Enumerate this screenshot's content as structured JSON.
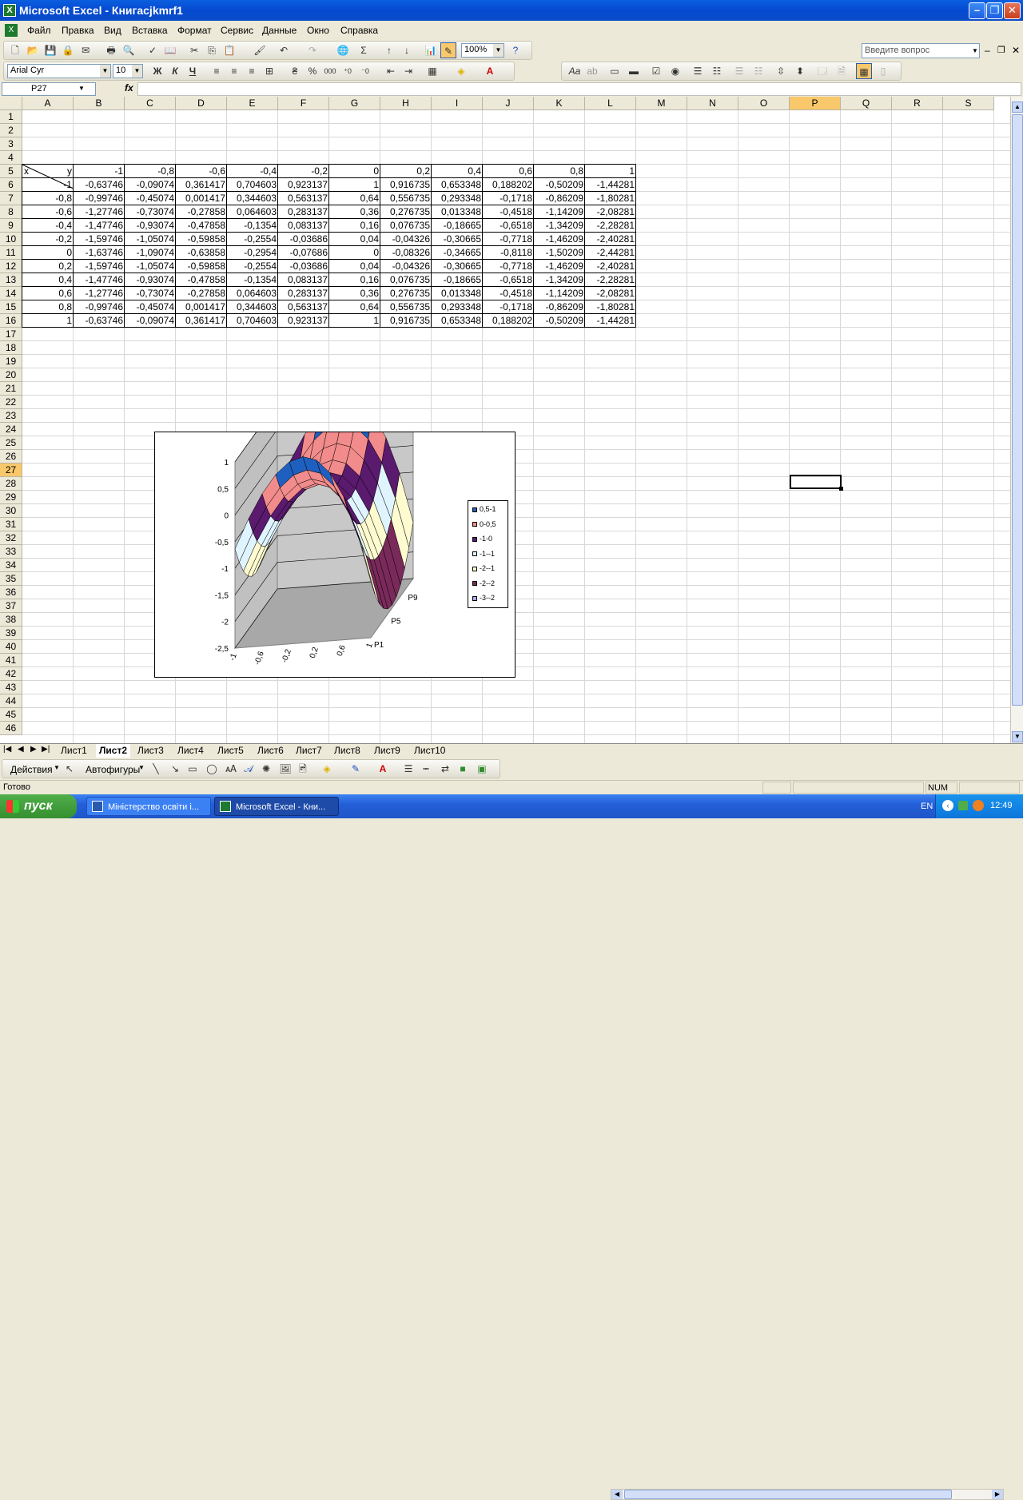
{
  "window": {
    "title": "Microsoft Excel - Книгаcjkmrf1",
    "icon": "excel-icon"
  },
  "menu": {
    "items": [
      "Файл",
      "Правка",
      "Вид",
      "Вставка",
      "Формат",
      "Сервис",
      "Данные",
      "Окно",
      "Справка"
    ],
    "question_placeholder": "Введите вопрос"
  },
  "toolbar": {
    "zoom": "100%",
    "font": "Arial Cyr",
    "size": "10"
  },
  "formula_bar": {
    "name_box": "P27",
    "fx_label": "fx",
    "content": ""
  },
  "columns": [
    "A",
    "B",
    "C",
    "D",
    "E",
    "F",
    "G",
    "H",
    "I",
    "J",
    "K",
    "L",
    "M",
    "N",
    "O",
    "P",
    "Q",
    "R",
    "S"
  ],
  "rows": [
    "1",
    "2",
    "3",
    "4",
    "5",
    "6",
    "7",
    "8",
    "9",
    "10",
    "11",
    "12",
    "13",
    "14",
    "15",
    "16",
    "17",
    "18",
    "19",
    "20",
    "21",
    "22",
    "23",
    "24",
    "25",
    "26",
    "27",
    "28",
    "29",
    "30",
    "31",
    "32",
    "33",
    "34",
    "35",
    "36",
    "37",
    "38",
    "39",
    "40",
    "41",
    "42",
    "43",
    "44",
    "45",
    "46"
  ],
  "selected": {
    "column": "P",
    "row": "27"
  },
  "table": {
    "corner_x": "x",
    "corner_y": "y",
    "header": [
      "-1",
      "-0,8",
      "-0,6",
      "-0,4",
      "-0,2",
      "0",
      "0,2",
      "0,4",
      "0,6",
      "0,8",
      "1"
    ],
    "body": [
      [
        "-1",
        "-0,63746",
        "-0,09074",
        "0,361417",
        "0,704603",
        "0,923137",
        "1",
        "0,916735",
        "0,653348",
        "0,188202",
        "-0,50209",
        "-1,44281"
      ],
      [
        "-0,8",
        "-0,99746",
        "-0,45074",
        "0,001417",
        "0,344603",
        "0,563137",
        "0,64",
        "0,556735",
        "0,293348",
        "-0,1718",
        "-0,86209",
        "-1,80281"
      ],
      [
        "-0,6",
        "-1,27746",
        "-0,73074",
        "-0,27858",
        "0,064603",
        "0,283137",
        "0,36",
        "0,276735",
        "0,013348",
        "-0,4518",
        "-1,14209",
        "-2,08281"
      ],
      [
        "-0,4",
        "-1,47746",
        "-0,93074",
        "-0,47858",
        "-0,1354",
        "0,083137",
        "0,16",
        "0,076735",
        "-0,18665",
        "-0,6518",
        "-1,34209",
        "-2,28281"
      ],
      [
        "-0,2",
        "-1,59746",
        "-1,05074",
        "-0,59858",
        "-0,2554",
        "-0,03686",
        "0,04",
        "-0,04326",
        "-0,30665",
        "-0,7718",
        "-1,46209",
        "-2,40281"
      ],
      [
        "0",
        "-1,63746",
        "-1,09074",
        "-0,63858",
        "-0,2954",
        "-0,07686",
        "0",
        "-0,08326",
        "-0,34665",
        "-0,8118",
        "-1,50209",
        "-2,44281"
      ],
      [
        "0,2",
        "-1,59746",
        "-1,05074",
        "-0,59858",
        "-0,2554",
        "-0,03686",
        "0,04",
        "-0,04326",
        "-0,30665",
        "-0,7718",
        "-1,46209",
        "-2,40281"
      ],
      [
        "0,4",
        "-1,47746",
        "-0,93074",
        "-0,47858",
        "-0,1354",
        "0,083137",
        "0,16",
        "0,076735",
        "-0,18665",
        "-0,6518",
        "-1,34209",
        "-2,28281"
      ],
      [
        "0,6",
        "-1,27746",
        "-0,73074",
        "-0,27858",
        "0,064603",
        "0,283137",
        "0,36",
        "0,276735",
        "0,013348",
        "-0,4518",
        "-1,14209",
        "-2,08281"
      ],
      [
        "0,8",
        "-0,99746",
        "-0,45074",
        "0,001417",
        "0,344603",
        "0,563137",
        "0,64",
        "0,556735",
        "0,293348",
        "-0,1718",
        "-0,86209",
        "-1,80281"
      ],
      [
        "1",
        "-0,63746",
        "-0,09074",
        "0,361417",
        "0,704603",
        "0,923137",
        "1",
        "0,916735",
        "0,653348",
        "0,188202",
        "-0,50209",
        "-1,44281"
      ]
    ]
  },
  "chart_data": {
    "type": "surface",
    "z_ticks": [
      "1",
      "0,5",
      "0",
      "-0,5",
      "-1",
      "-1,5",
      "-2",
      "-2,5"
    ],
    "x_ticks": [
      "-1",
      "-0,6",
      "-0,2",
      "0,2",
      "0,6",
      "1"
    ],
    "depth_ticks": [
      "P9",
      "P5",
      "P1"
    ],
    "legend": [
      {
        "label": "0,5-1",
        "color": "#1f5fbf"
      },
      {
        "label": "0-0,5",
        "color": "#f28b8b"
      },
      {
        "label": "-1-0",
        "color": "#5a1a6e"
      },
      {
        "label": "-1--1",
        "color": "#dff4ff"
      },
      {
        "label": "-2--1",
        "color": "#fffbd0"
      },
      {
        "label": "-2--2",
        "color": "#7a2a5a"
      },
      {
        "label": "-3--2",
        "color": "#a8a8f0"
      }
    ],
    "legend_position": "right"
  },
  "sheets": {
    "tabs": [
      "Лист1",
      "Лист2",
      "Лист3",
      "Лист4",
      "Лист5",
      "Лист6",
      "Лист7",
      "Лист8",
      "Лист9",
      "Лист10"
    ],
    "active": "Лист2"
  },
  "drawing_toolbar": {
    "actions": "Действия",
    "autoshapes": "Автофигуры"
  },
  "status": {
    "left": "Готово",
    "num": "NUM"
  },
  "taskbar": {
    "start": "пуск",
    "tasks": [
      "Міністерство освіти і...",
      "Microsoft Excel - Кни..."
    ],
    "lang": "EN",
    "time": "12:49"
  }
}
